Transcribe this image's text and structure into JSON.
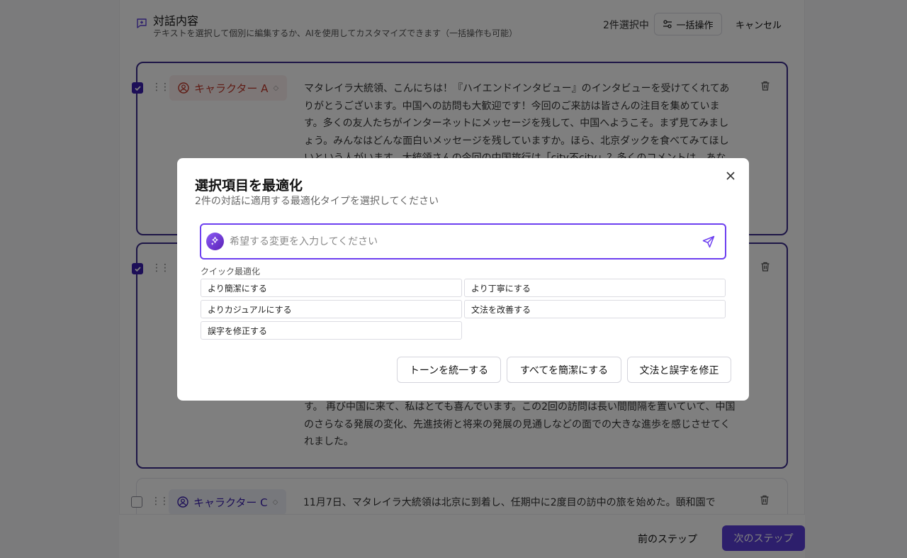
{
  "section": {
    "title": "対話内容",
    "subtitle": "テキストを選択して個別に編集するか、AIを使用してカスタマイズできます（一括操作も可能）",
    "selected_count": "2件選択中",
    "bulk_label": "一括操作",
    "cancel_label": "キャンセル"
  },
  "cards": [
    {
      "speaker": "キャラクター A",
      "checked": true,
      "text": "マタレイラ大統領、こんにちは！『ハイエンドインタビュー』のインタビューを受けてくれてありがとうございます。中国への訪問も大歓迎です！今回のご来訪は皆さんの注目を集めています。多くの友人たちがインターネットにメッセージを残して、中国へようこそ。まず見てみましょう。みんなはどんな面白いメッセージを残していますか。ほら、北京ダックを食べてみてほしいという人がいます。大統領さんの今回の中国旅行は「city不city」？多くのコメントは、あな"
    },
    {
      "speaker": "",
      "checked": true,
      "text": "す。 再び中国に来て、私はとても喜んでいます。この2回の訪問は長い間間隔を置いていて、中国のさらなる発展の変化、先進技術と将来の発展の見通しなどの面での大きな進歩を感じさせてくれました。"
    },
    {
      "speaker": "キャラクター C",
      "checked": false,
      "text": "11月7日、マタレイラ大統領は北京に到着し、任期中に2度目の訪中の旅を始めた。頤和園で"
    }
  ],
  "footer": {
    "prev_label": "前のステップ",
    "next_label": "次のステップ"
  },
  "modal": {
    "title": "選択項目を最適化",
    "description": "2件の対話に適用する最適化タイプを選択してください",
    "prompt_placeholder": "希望する変更を入力してください",
    "prompt_value": "",
    "quick_label": "クイック最適化",
    "chips": [
      "より簡潔にする",
      "より丁寧にする",
      "よりカジュアルにする",
      "文法を改善する",
      "誤字を修正する"
    ],
    "actions": [
      "トーンを統一する",
      "すべてを簡潔にする",
      "文法と誤字を修正"
    ]
  },
  "colors": {
    "accent": "#6d3ff0",
    "selected_border": "#3a2a8c",
    "speaker_a": "#c0392b",
    "speaker_c": "#3b1fb0"
  }
}
